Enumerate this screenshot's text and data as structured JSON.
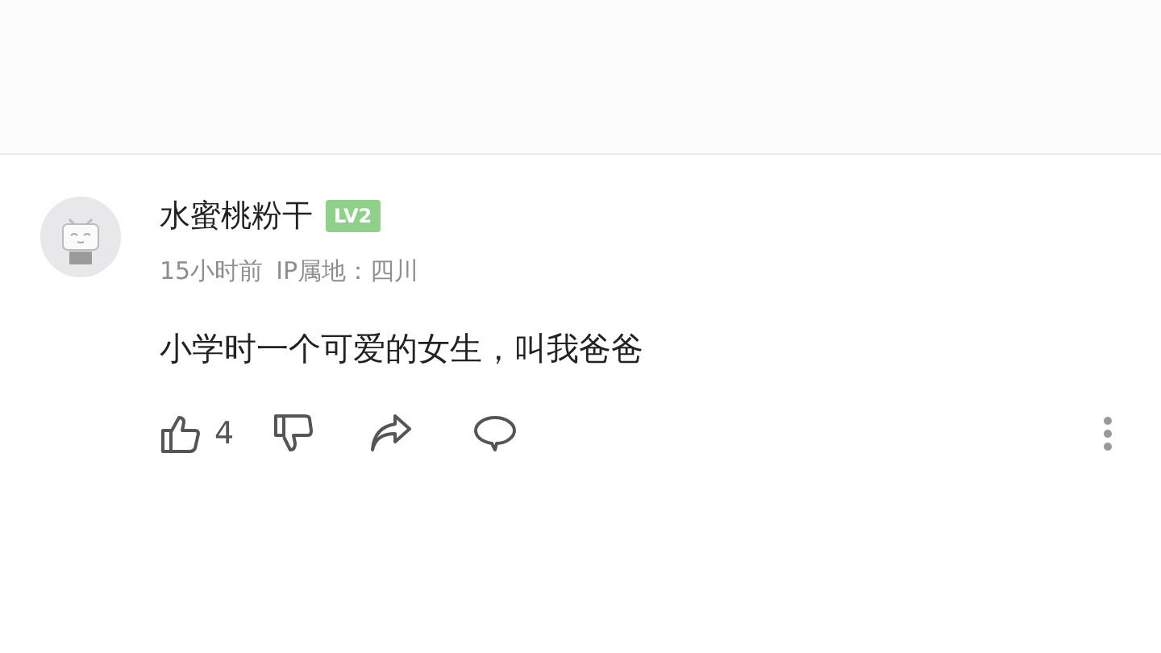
{
  "comment": {
    "username": "水蜜桃粉干",
    "level_badge": "LV2",
    "time": "15小时前",
    "location": "IP属地：四川",
    "text": "小学时一个可爱的女生，叫我爸爸",
    "like_count": "4"
  }
}
